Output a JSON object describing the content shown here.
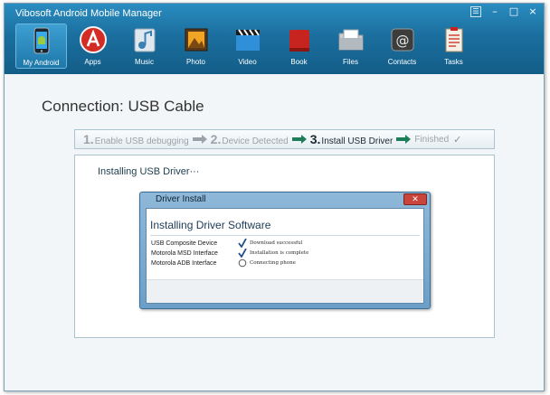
{
  "app": {
    "title": "Vibosoft Android Mobile Manager"
  },
  "window_controls": {
    "menu": "☰",
    "minimize": "–",
    "maximize": "□",
    "close": "×"
  },
  "nav": {
    "items": [
      {
        "label": "My Android",
        "icon": "android-phone-icon",
        "active": true
      },
      {
        "label": "Apps",
        "icon": "apps-icon",
        "active": false
      },
      {
        "label": "Music",
        "icon": "music-icon",
        "active": false
      },
      {
        "label": "Photo",
        "icon": "photo-icon",
        "active": false
      },
      {
        "label": "Video",
        "icon": "video-icon",
        "active": false
      },
      {
        "label": "Book",
        "icon": "book-icon",
        "active": false
      },
      {
        "label": "Files",
        "icon": "files-icon",
        "active": false
      },
      {
        "label": "Contacts",
        "icon": "contacts-icon",
        "active": false
      },
      {
        "label": "Tasks",
        "icon": "tasks-icon",
        "active": false
      }
    ]
  },
  "connection": {
    "title": "Connection: USB Cable"
  },
  "steps": [
    {
      "num": "1.",
      "label": "Enable USB debugging"
    },
    {
      "num": "2.",
      "label": "Device Detected"
    },
    {
      "num": "3.",
      "label": "Install USB Driver"
    },
    {
      "num": "",
      "label": "Finished"
    }
  ],
  "panel": {
    "installing_label": "Installing USB Driver···"
  },
  "dialog": {
    "title": "Driver Install",
    "heading": "Installing Driver Software",
    "rows": [
      {
        "device": "USB Composite Device",
        "status": "Download successful",
        "state": "done"
      },
      {
        "device": "Motorola MSD Interface",
        "status": "Installation is complete",
        "state": "done"
      },
      {
        "device": "Motorola ADB Interface",
        "status": "Connecting phone",
        "state": "pending"
      }
    ]
  },
  "colors": {
    "titlebar": "#1b6f9f",
    "step_arrow_active": "#1e7e5a",
    "step_arrow_inactive": "#9aa3a8",
    "check_blue": "#1f4e8c"
  }
}
